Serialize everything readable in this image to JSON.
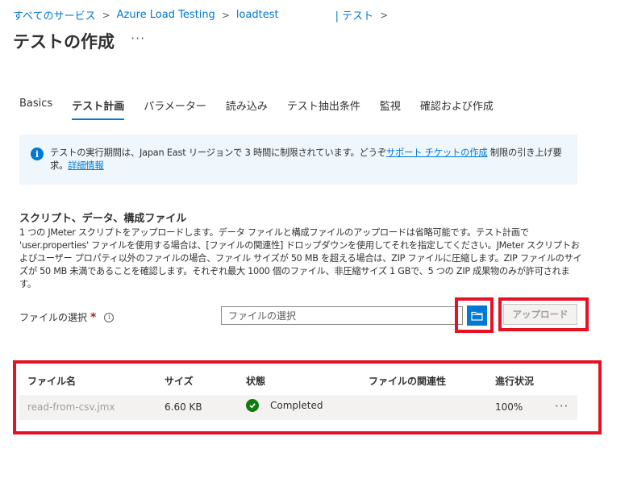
{
  "breadcrumb": {
    "items": [
      "すべてのサービス",
      "Azure Load Testing",
      "loadtest",
      "| テスト"
    ]
  },
  "page": {
    "title": "テストの作成",
    "more": "···"
  },
  "tabs": [
    "Basics",
    "テスト計画",
    "パラメーター",
    "読み込み",
    "テスト抽出条件",
    "監視",
    "確認および作成"
  ],
  "info": {
    "icon": "i",
    "text_before": "テストの実行期間は、Japan East リージョンで 3 時間に制限されています。どうぞ",
    "link1": "サポート チケットの作成",
    "text_mid": " 制限の引き上げ要求。",
    "link2": "詳細情報"
  },
  "section": {
    "title": "スクリプト、データ、構成ファイル",
    "description": "1 つの JMeter スクリプトをアップロードします。データ ファイルと構成ファイルのアップロードは省略可能です。テスト計画で 'user.properties' ファイルを使用する場合は、[ファイルの関連性] ドロップダウンを使用してそれを指定してください。JMeter スクリプトおよびユーザー プロパティ以外のファイルの場合、ファイル サイズが 50 MB を超える場合は、ZIP ファイルに圧縮します。ZIP ファイルのサイズが 50 MB 未満であることを確認します。それぞれ最大 1000 個のファイル、非圧縮サイズ 1 GBで、5 つの ZIP 成果物のみが許可されます。"
  },
  "file_select": {
    "label": "ファイルの選択",
    "required": "*",
    "info_icon": "i",
    "placeholder": "ファイルの選択",
    "upload_label": "アップロード"
  },
  "table": {
    "headers": [
      "ファイル名",
      "サイズ",
      "状態",
      "ファイルの関連性",
      "進行状況"
    ],
    "rows": [
      {
        "name": "read-from-csv.jmx",
        "size": "6.60 KB",
        "status": "Completed",
        "relevance": "",
        "progress": "100%",
        "more": "···"
      }
    ]
  },
  "colors": {
    "accent": "#0078d4",
    "highlight": "#e81123",
    "success": "#107c10",
    "info_bg": "#eff6fc"
  }
}
